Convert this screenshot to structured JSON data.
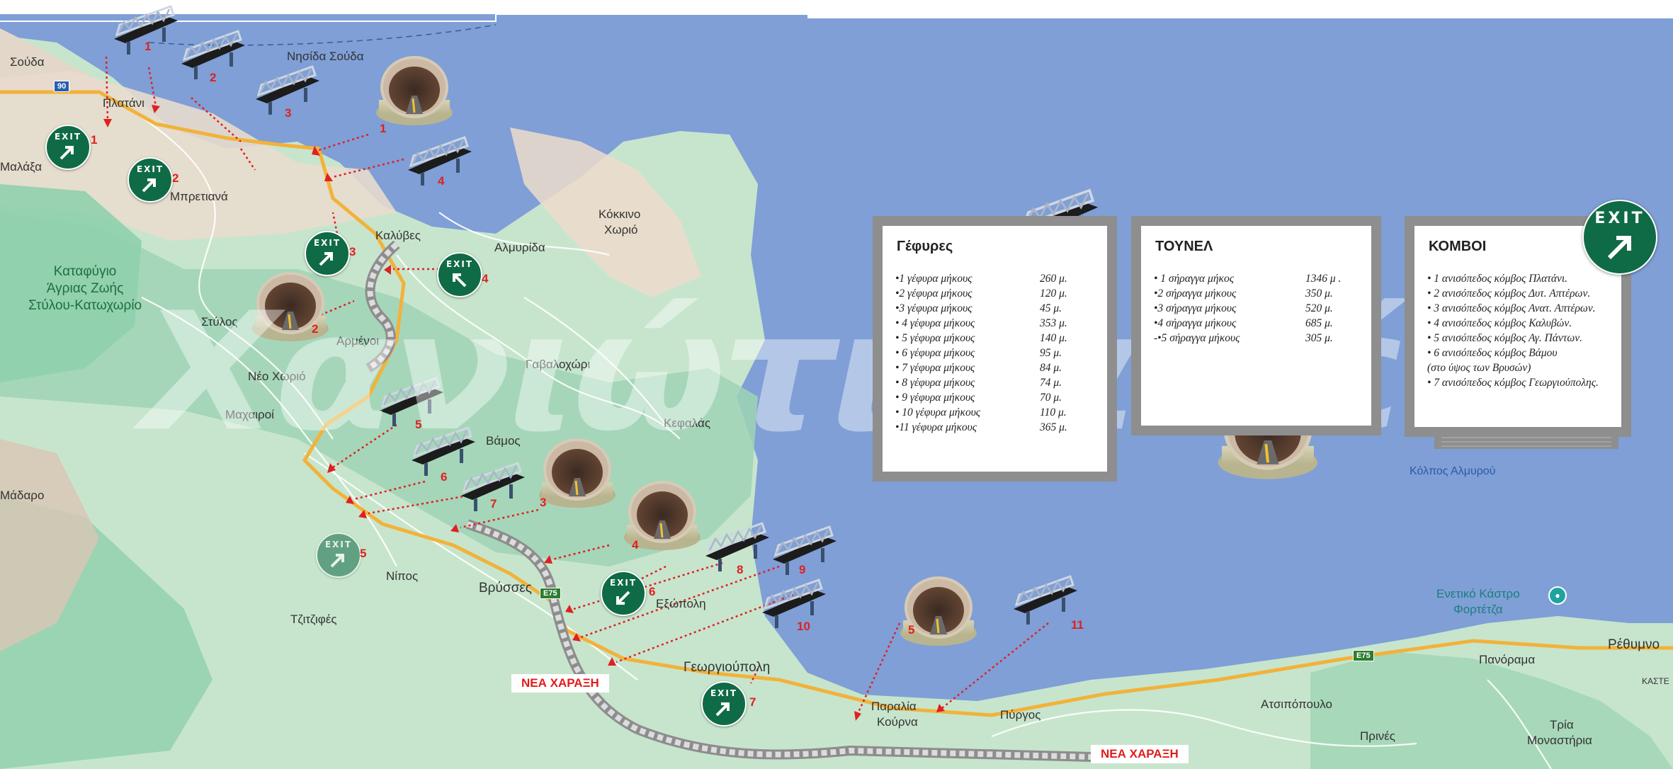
{
  "places": {
    "souda": "Σούδα",
    "souda_island": "Νησίδα Σούδα",
    "platani": "Πλατάνι",
    "malaxa": "Μαλάξα",
    "mpretiana": "Μπρετιανά",
    "kokkino_xorio_1": "Κόκκινο",
    "kokkino_xorio_2": "Χωριό",
    "kalyves": "Καλύβες",
    "almyrida": "Αλμυρίδα",
    "reserve_1": "Καταφύγιο",
    "reserve_2": "Άγριας Ζωής",
    "reserve_3": "Στύλου-Κατωχωρίο",
    "stylos": "Στύλος",
    "armenoi": "Αρμένοι",
    "neo_xorio": "Νέο Χωριό",
    "gavalochori": "Γαβαλοχώρι",
    "machairoi": "Μαχαιροί",
    "vamos": "Βάμος",
    "kefalas": "Κεφαλάς",
    "madaro": "Μάδαρο",
    "nipos": "Νίπος",
    "vrysses": "Βρύσσες",
    "exopoli": "Εξώπολη",
    "tzitzifes": "Τζιτζιφές",
    "georgioupoli": "Γεωργιούπολη",
    "paralia_kourna_1": "Παραλία",
    "paralia_kourna_2": "Κούρνα",
    "pyrgos": "Πύργος",
    "atsipopoulo": "Ατσιπόπουλο",
    "prines": "Πρινές",
    "panorama": "Πανόραμα",
    "tria_monastiria_1": "Τρία",
    "tria_monastiria_2": "Μοναστήρια",
    "rethymno": "Ρέθυμνο",
    "kaste": "ΚΑΣΤΕ",
    "kolpos": "Κόλπος Αλμυρού",
    "fortezza_1": "Ενετικό Κάστρο",
    "fortezza_2": "Φορτέτζα"
  },
  "roads": {
    "r90": "90",
    "e75a": "E75",
    "e75b": "E75"
  },
  "new_route_label": "ΝΕΑ ΧΑΡΑΞΗ",
  "exit_text": "EXIT",
  "markers": {
    "bridges": [
      "1",
      "2",
      "3",
      "4",
      "5",
      "6",
      "7",
      "8",
      "9",
      "10",
      "11"
    ],
    "tunnels": [
      "1",
      "2",
      "3",
      "4",
      "5"
    ],
    "exits": [
      "1",
      "2",
      "3",
      "4",
      "5",
      "6",
      "7"
    ]
  },
  "panels": {
    "bridges": {
      "title": "Γέφυρες",
      "rows": [
        {
          "label": "•1 γέφυρα μήκους",
          "value": "260 μ."
        },
        {
          "label": "•2 γέφυρα μήκους",
          "value": "120 μ."
        },
        {
          "label": "•3 γέφυρα μήκους",
          "value": "45 μ."
        },
        {
          "label": "• 4 γέφυρα μήκους",
          "value": "353 μ."
        },
        {
          "label": "• 5 γέφυρα μήκους",
          "value": "140 μ."
        },
        {
          "label": "• 6  γέφυρα μήκους",
          "value": "95 μ."
        },
        {
          "label": "• 7  γέφυρα μήκους",
          "value": "84 μ."
        },
        {
          "label": "• 8 γέφυρα μήκους",
          "value": "74 μ."
        },
        {
          "label": "• 9  γέφυρα μήκους",
          "value": "70 μ."
        },
        {
          "label": "• 10  γέφυρα μήκους",
          "value": "110 μ."
        },
        {
          "label": "•11 γέφυρα μήκους",
          "value": "365 μ."
        }
      ]
    },
    "tunnels": {
      "title": "ΤΟΥΝΕΛ",
      "rows": [
        {
          "label": "• 1 σήραγγα μήκος",
          "value": "1346 μ ."
        },
        {
          "label": "•2 σήραγγα μήκους",
          "value": "350 μ."
        },
        {
          "label": "•3 σήραγγα μήκους",
          "value": "520 μ."
        },
        {
          "label": "•4 σήραγγα μήκους",
          "value": "685 μ."
        },
        {
          "label": "-•5 σήραγγα μήκους",
          "value": "305 μ."
        }
      ]
    },
    "junctions": {
      "title": "ΚΟΜΒΟΙ",
      "rows": [
        "• 1 ανισόπεδος κόμβος Πλατάνι.",
        "•  2  ανισόπεδος κόμβος Δυτ. Απτέρων.",
        "•  3  ανισόπεδος κόμβος Ανατ. Απτέρων.",
        "•  4  ανισόπεδος κόμβος Καλυβών.",
        "•  5  ανισόπεδος κόμβος Αγ. Πάντων.",
        "•  6  ανισόπεδος κόμβος Βάμου",
        "   (στο ύψος των Βρυσών)",
        "•  7  ανισόπεδος κόμβος Γεωργιούπολης."
      ]
    }
  },
  "watermark": "Χανιώτικα νέα",
  "colors": {
    "sea": "#7f9fd6",
    "land": "#c7e5cd",
    "forest": "#8fd0ad",
    "highway": "#f2b23a",
    "exit_green": "#0f6b45",
    "arrow_red": "#e02020"
  }
}
